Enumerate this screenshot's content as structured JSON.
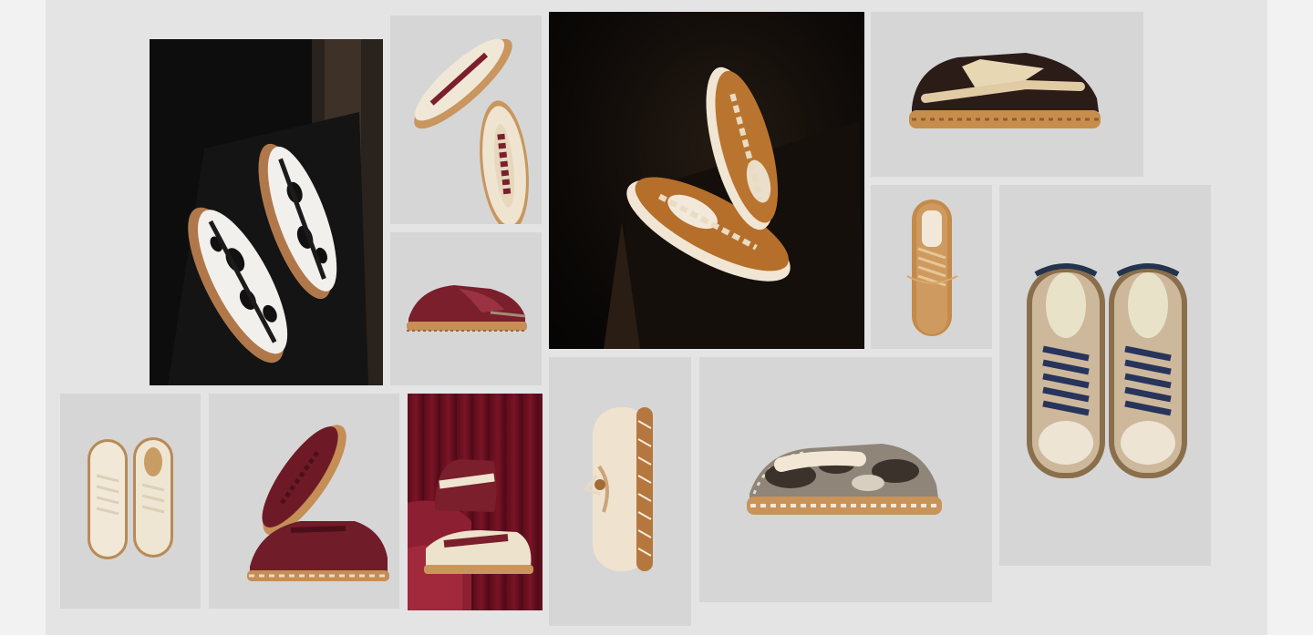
{
  "gallery": {
    "tiles": [
      {
        "id": "cow-print-pair",
        "shoe": "cow-print-sneaker-pair"
      },
      {
        "id": "shearling-burgundy-pair",
        "shoe": "cream-shearling-sneaker-burgundy-laces"
      },
      {
        "id": "burgundy-suede-side",
        "shoe": "burgundy-suede-sneaker"
      },
      {
        "id": "pony-hair-tan-pair",
        "shoe": "tan-pony-hair-sneaker-pair"
      },
      {
        "id": "dark-brown-pony-side",
        "shoe": "dark-brown-pony-hair-sneaker"
      },
      {
        "id": "tan-top-view",
        "shoe": "tan-leather-sneaker-top-view"
      },
      {
        "id": "blue-lace-shearling-pair",
        "shoe": "olive-shearling-sneakers-navy-laces"
      },
      {
        "id": "cream-pair-top",
        "shoe": "cream-leather-sneaker-pair"
      },
      {
        "id": "burgundy-textured-pair",
        "shoe": "burgundy-textured-sneaker-pair"
      },
      {
        "id": "burgundy-high-top-curtain",
        "shoe": "burgundy-cream-high-top"
      },
      {
        "id": "cream-sole-view",
        "shoe": "cream-sneaker-sole-view"
      },
      {
        "id": "python-shearling-side",
        "shoe": "python-print-shearling-sneaker"
      }
    ]
  },
  "colors": {
    "page": "#f2f2f2",
    "board": "#e4e4e4",
    "tile_light": "#d6d6d6",
    "gum_sole": "#b07a45",
    "burgundy": "#7a1f2b",
    "cream": "#efe4d0",
    "tan": "#b9752f",
    "navy": "#27345c"
  }
}
